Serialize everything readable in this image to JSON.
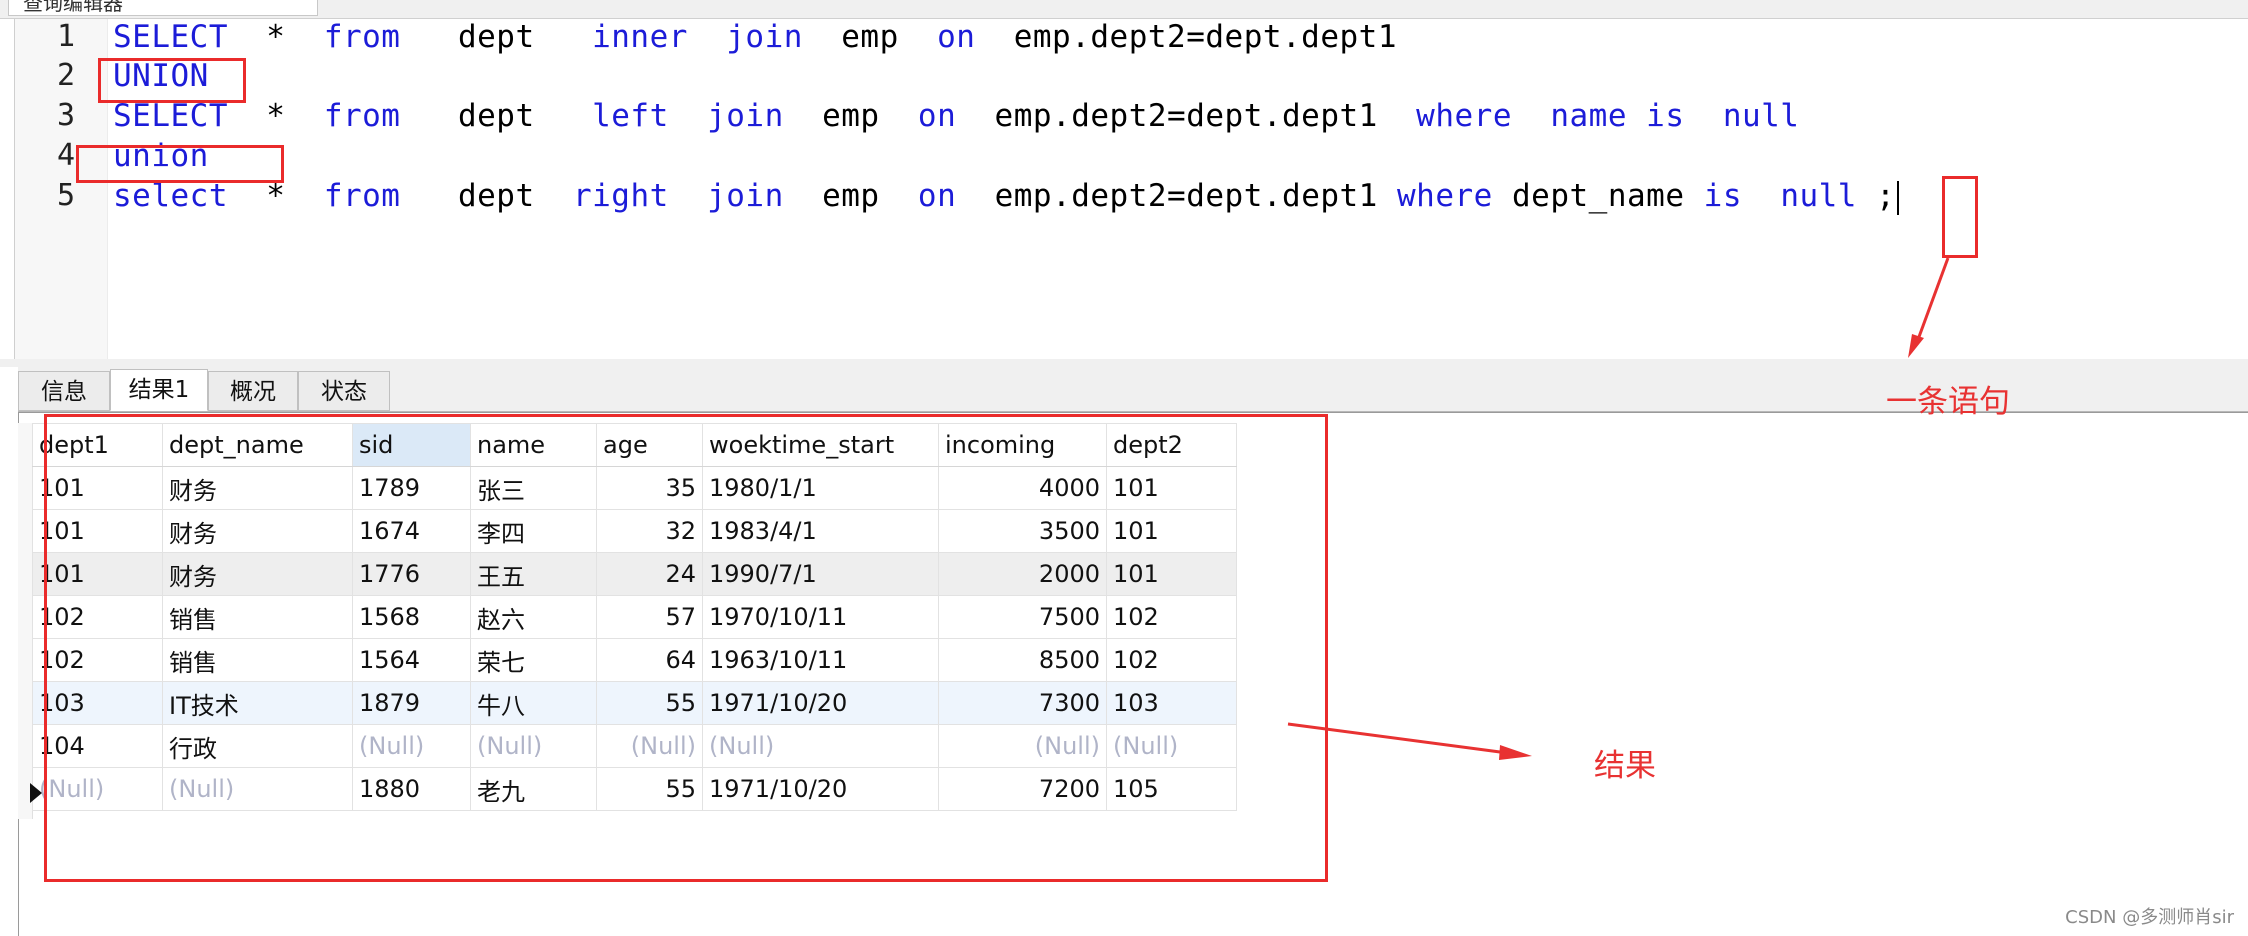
{
  "window": {
    "top_tab_label": "查询编辑器"
  },
  "editor": {
    "lines": [
      {
        "no": "1",
        "tokens": [
          {
            "t": "SELECT",
            "kw": true
          },
          {
            "t": "  *  ",
            "kw": false
          },
          {
            "t": "from",
            "kw": true
          },
          {
            "t": "   dept   ",
            "kw": false
          },
          {
            "t": "inner",
            "kw": true
          },
          {
            "t": "  ",
            "kw": false
          },
          {
            "t": "join",
            "kw": true
          },
          {
            "t": "  emp  ",
            "kw": false
          },
          {
            "t": "on",
            "kw": true
          },
          {
            "t": "  emp.dept2=dept.dept1",
            "kw": false
          }
        ]
      },
      {
        "no": "2",
        "tokens": [
          {
            "t": "UNION",
            "kw": true
          }
        ]
      },
      {
        "no": "3",
        "tokens": [
          {
            "t": "SELECT",
            "kw": true
          },
          {
            "t": "  *  ",
            "kw": false
          },
          {
            "t": "from",
            "kw": true
          },
          {
            "t": "   dept   ",
            "kw": false
          },
          {
            "t": "left",
            "kw": true
          },
          {
            "t": "  ",
            "kw": false
          },
          {
            "t": "join",
            "kw": true
          },
          {
            "t": "  emp  ",
            "kw": false
          },
          {
            "t": "on",
            "kw": true
          },
          {
            "t": "  emp.dept2=dept.dept1  ",
            "kw": false
          },
          {
            "t": "where",
            "kw": true
          },
          {
            "t": "  ",
            "kw": false
          },
          {
            "t": "name",
            "kw": true
          },
          {
            "t": " ",
            "kw": false
          },
          {
            "t": "is",
            "kw": true
          },
          {
            "t": "  ",
            "kw": false
          },
          {
            "t": "null",
            "kw": true
          }
        ]
      },
      {
        "no": "4",
        "tokens": [
          {
            "t": "union",
            "kw": true
          }
        ]
      },
      {
        "no": "5",
        "tokens": [
          {
            "t": "select",
            "kw": true
          },
          {
            "t": "  *  ",
            "kw": false
          },
          {
            "t": "from",
            "kw": true
          },
          {
            "t": "   dept  ",
            "kw": false
          },
          {
            "t": "right",
            "kw": true
          },
          {
            "t": "  ",
            "kw": false
          },
          {
            "t": "join",
            "kw": true
          },
          {
            "t": "  emp  ",
            "kw": false
          },
          {
            "t": "on",
            "kw": true
          },
          {
            "t": "  emp.dept2=dept.dept1 ",
            "kw": false
          },
          {
            "t": "where",
            "kw": true
          },
          {
            "t": " dept_name ",
            "kw": false
          },
          {
            "t": "is",
            "kw": true
          },
          {
            "t": "  ",
            "kw": false
          },
          {
            "t": "null",
            "kw": true
          },
          {
            "t": " ;",
            "kw": false
          }
        ]
      }
    ]
  },
  "result_tabs": [
    "信息",
    "结果1",
    "概况",
    "状态"
  ],
  "active_tab": "结果1",
  "grid": {
    "columns": [
      "dept1",
      "dept_name",
      "sid",
      "name",
      "age",
      "woektime_start",
      "incoming",
      "dept2"
    ],
    "selected_column": "sid",
    "numeric_columns": [
      "age",
      "incoming"
    ],
    "null_text": "(Null)",
    "rows": [
      [
        "101",
        "财务",
        "1789",
        "张三",
        "35",
        "1980/1/1",
        "4000",
        "101"
      ],
      [
        "101",
        "财务",
        "1674",
        "李四",
        "32",
        "1983/4/1",
        "3500",
        "101"
      ],
      [
        "101",
        "财务",
        "1776",
        "王五",
        "24",
        "1990/7/1",
        "2000",
        "101"
      ],
      [
        "102",
        "销售",
        "1568",
        "赵六",
        "57",
        "1970/10/11",
        "7500",
        "102"
      ],
      [
        "102",
        "销售",
        "1564",
        "荣七",
        "64",
        "1963/10/11",
        "8500",
        "102"
      ],
      [
        "103",
        "IT技术",
        "1879",
        "牛八",
        "55",
        "1971/10/20",
        "7300",
        "103"
      ],
      [
        "104",
        "行政",
        "(Null)",
        "(Null)",
        "(Null)",
        "(Null)",
        "(Null)",
        "(Null)"
      ],
      [
        "(Null)",
        "(Null)",
        "1880",
        "老九",
        "55",
        "1971/10/20",
        "7200",
        "105"
      ]
    ],
    "highlight_gray_row": 2,
    "highlight_blue_row": 5,
    "current_row": 7
  },
  "annotations": {
    "statement_label": "一条语句",
    "result_label": "结果",
    "color": "#e83232"
  },
  "watermark": "CSDN @多测师肖sir"
}
